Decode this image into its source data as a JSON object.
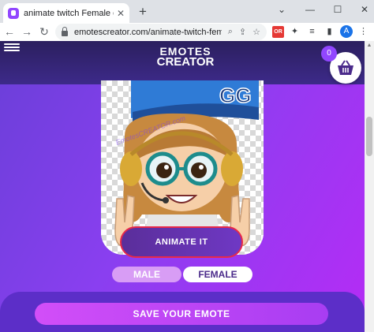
{
  "browser": {
    "tab_title": "animate twitch Female emote - E",
    "tab_close": "✕",
    "new_tab": "+",
    "url": "emotescreator.com/animate-twitch-fem...",
    "avatar_initial": "A",
    "extension_badge": "OR"
  },
  "site": {
    "logo_line1": "EMOTES",
    "logo_line2": "CREATOR",
    "cart_count": "0",
    "watermark_text": "EmotesCREATOR.com"
  },
  "editor": {
    "animate_label": "ANIMATE IT",
    "gender_options": [
      "MALE",
      "FEMALE"
    ],
    "selected_gender": "FEMALE",
    "save_label": "SAVE YOUR EMOTE"
  },
  "colors": {
    "brand_purple": "#9146ff",
    "header_bg": "#2b1f5e",
    "animate_border": "#e8294a",
    "save_button": "#d24ef8"
  }
}
